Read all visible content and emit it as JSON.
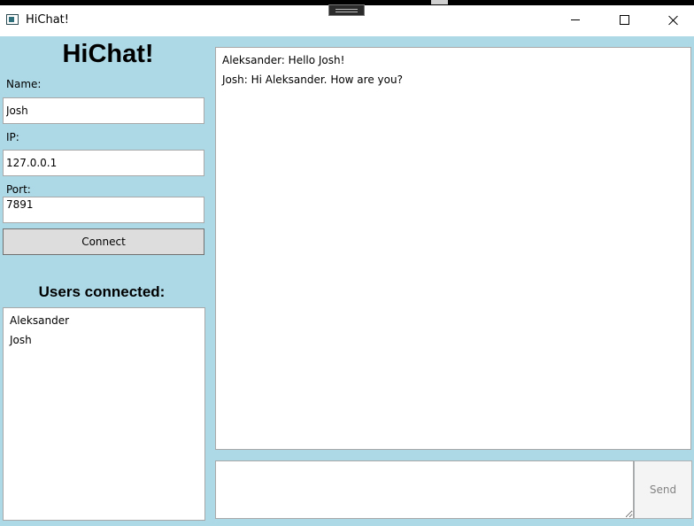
{
  "window": {
    "title": "HiChat!",
    "icons": {
      "app": "app-icon",
      "minimize": "minimize-icon",
      "maximize": "maximize-icon",
      "close": "close-icon"
    }
  },
  "app": {
    "heading": "HiChat!"
  },
  "form": {
    "name": {
      "label": "Name:",
      "value": "Josh"
    },
    "ip": {
      "label": "IP:",
      "value": "127.0.0.1"
    },
    "port": {
      "label": "Port:",
      "value": "7891"
    },
    "connect_label": "Connect"
  },
  "users": {
    "title": "Users connected:",
    "items": [
      "Aleksander",
      "Josh"
    ]
  },
  "chat": {
    "messages": [
      "Aleksander: Hello Josh!",
      "Josh: Hi Aleksander. How are you?"
    ],
    "input_value": "",
    "send_label": "Send"
  },
  "colors": {
    "background": "#add8e6",
    "button": "#dddddd",
    "send_disabled_text": "#838383"
  }
}
